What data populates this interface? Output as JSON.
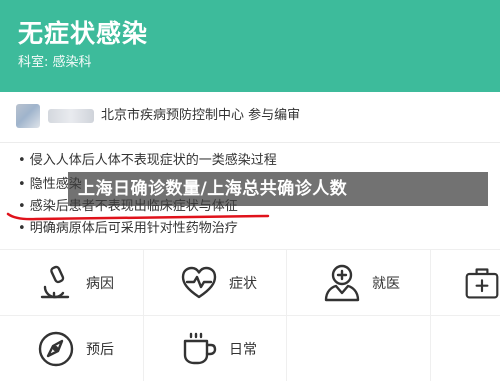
{
  "header": {
    "title": "无症状感染",
    "department": "科室: 感染科",
    "background_color": "#3dbb9b"
  },
  "source": {
    "text": "北京市疾病预防控制中心 参与编审"
  },
  "symptoms": [
    "• 侵入人体后人体不表现症状的一类感染过程",
    "• 隐性感染",
    "• 感染后患者不表现出临床症状与体征",
    "• 明确病原体后可采用针对性药物治疗"
  ],
  "overlay": {
    "title": "上海日确诊数量/上海总共确诊人数"
  },
  "nav": [
    {
      "label": "病因",
      "icon": "microscope-icon"
    },
    {
      "label": "症状",
      "icon": "heartbeat-icon"
    },
    {
      "label": "就医",
      "icon": "doctor-icon"
    },
    {
      "label": "",
      "icon": "medical-kit-icon"
    },
    {
      "label": "预后",
      "icon": "compass-icon"
    },
    {
      "label": "日常",
      "icon": "cup-icon"
    }
  ],
  "accent_color": "#e0121b"
}
